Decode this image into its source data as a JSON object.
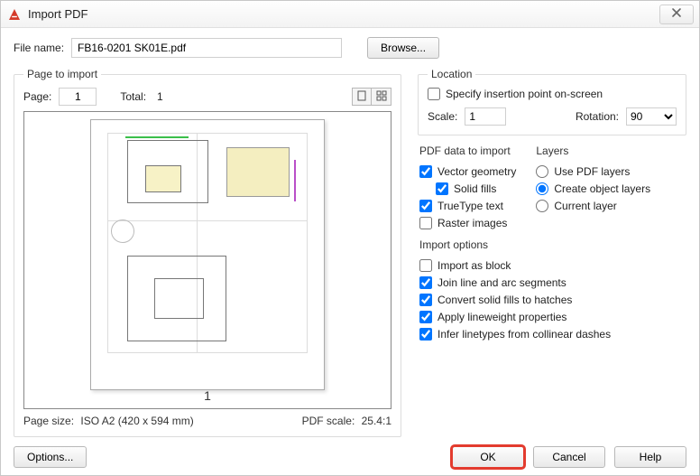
{
  "window": {
    "title": "Import PDF"
  },
  "file": {
    "label": "File name:",
    "value": "FB16-0201 SK01E.pdf",
    "browse": "Browse..."
  },
  "pageToImport": {
    "legend": "Page to import",
    "pageLabel": "Page:",
    "pageValue": "1",
    "totalLabel": "Total:",
    "totalValue": "1",
    "previewPageNumber": "1",
    "pageSizeLabel": "Page size:",
    "pageSizeValue": "ISO A2 (420 x 594 mm)",
    "pdfScaleLabel": "PDF scale:",
    "pdfScaleValue": "25.4:1"
  },
  "location": {
    "legend": "Location",
    "specifyOnScreen": {
      "label": "Specify insertion point on-screen",
      "checked": false
    },
    "scaleLabel": "Scale:",
    "scaleValue": "1",
    "rotationLabel": "Rotation:",
    "rotationValue": "90"
  },
  "pdfData": {
    "head": "PDF data to import",
    "vectorGeometry": {
      "label": "Vector geometry",
      "checked": true
    },
    "solidFills": {
      "label": "Solid fills",
      "checked": true
    },
    "trueType": {
      "label": "TrueType text",
      "checked": true
    },
    "rasterImages": {
      "label": "Raster images",
      "checked": false
    }
  },
  "layers": {
    "head": "Layers",
    "usePdf": "Use PDF layers",
    "createObject": "Create object layers",
    "currentLayer": "Current layer",
    "selected": "createObject"
  },
  "importOptions": {
    "head": "Import options",
    "importAsBlock": {
      "label": "Import as block",
      "checked": false
    },
    "joinLineArc": {
      "label": "Join line and arc segments",
      "checked": true
    },
    "convertSolidFills": {
      "label": "Convert solid fills to hatches",
      "checked": true
    },
    "applyLineweight": {
      "label": "Apply lineweight properties",
      "checked": true
    },
    "inferLinetypes": {
      "label": "Infer linetypes from collinear dashes",
      "checked": true
    }
  },
  "footer": {
    "options": "Options...",
    "ok": "OK",
    "cancel": "Cancel",
    "help": "Help"
  }
}
